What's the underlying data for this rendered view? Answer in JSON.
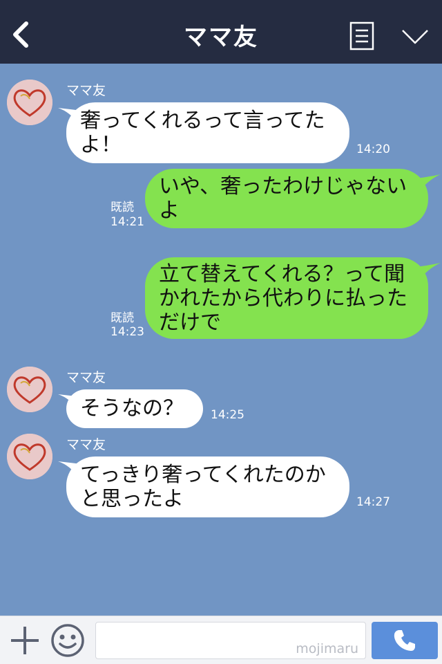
{
  "header": {
    "title": "ママ友",
    "back_icon": "chevron-left-icon",
    "menu_icon": "notes-icon",
    "more_icon": "chevron-down-icon",
    "background": "#252c41"
  },
  "chat": {
    "background": "#7195c4",
    "incoming_bubble_color": "#ffffff",
    "outgoing_bubble_color": "#84e24f",
    "messages": [
      {
        "direction": "in",
        "sender": "ママ友",
        "lines": [
          "奢ってくれるって言ってた",
          "よ！"
        ],
        "time": "14:20"
      },
      {
        "direction": "out",
        "lines": [
          "いや、奢ったわけじゃない",
          "よ"
        ],
        "read": "既読",
        "time": "14:21"
      },
      {
        "direction": "out",
        "lines": [
          "立て替えてくれる？って聞",
          "かれたから代わりに払った",
          "だけで"
        ],
        "read": "既読",
        "time": "14:23"
      },
      {
        "direction": "in",
        "sender": "ママ友",
        "lines": [
          "そうなの？"
        ],
        "time": "14:25"
      },
      {
        "direction": "in",
        "sender": "ママ友",
        "lines": [
          "てっきり奢ってくれたのか",
          "と思ったよ"
        ],
        "time": "14:27"
      }
    ]
  },
  "input_bar": {
    "plus_icon": "plus-icon",
    "emoji_icon": "smiley-icon",
    "watermark": "mojimaru",
    "call_icon": "phone-icon",
    "call_button_color": "#5b8fdb"
  }
}
